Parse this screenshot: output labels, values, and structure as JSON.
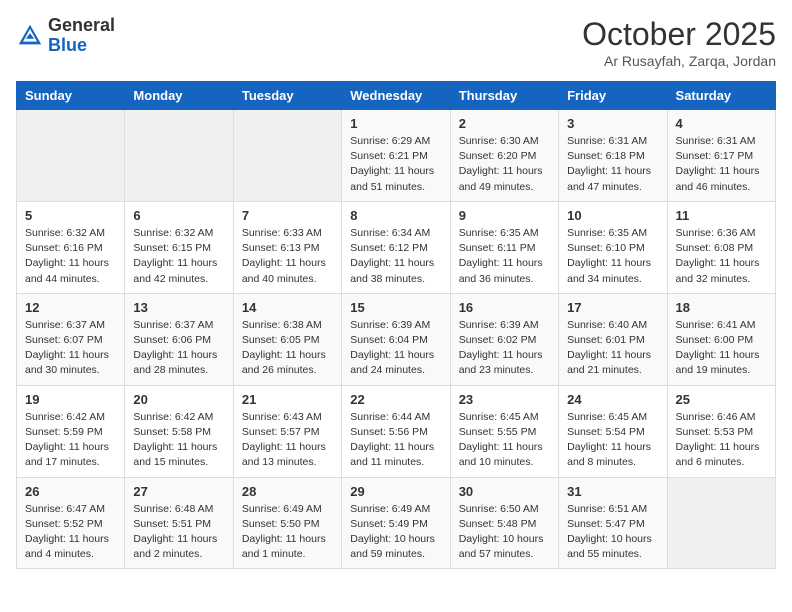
{
  "header": {
    "logo_general": "General",
    "logo_blue": "Blue",
    "month": "October 2025",
    "location": "Ar Rusayfah, Zarqa, Jordan"
  },
  "days_of_week": [
    "Sunday",
    "Monday",
    "Tuesday",
    "Wednesday",
    "Thursday",
    "Friday",
    "Saturday"
  ],
  "weeks": [
    [
      {
        "day": "",
        "info": ""
      },
      {
        "day": "",
        "info": ""
      },
      {
        "day": "",
        "info": ""
      },
      {
        "day": "1",
        "info": "Sunrise: 6:29 AM\nSunset: 6:21 PM\nDaylight: 11 hours\nand 51 minutes."
      },
      {
        "day": "2",
        "info": "Sunrise: 6:30 AM\nSunset: 6:20 PM\nDaylight: 11 hours\nand 49 minutes."
      },
      {
        "day": "3",
        "info": "Sunrise: 6:31 AM\nSunset: 6:18 PM\nDaylight: 11 hours\nand 47 minutes."
      },
      {
        "day": "4",
        "info": "Sunrise: 6:31 AM\nSunset: 6:17 PM\nDaylight: 11 hours\nand 46 minutes."
      }
    ],
    [
      {
        "day": "5",
        "info": "Sunrise: 6:32 AM\nSunset: 6:16 PM\nDaylight: 11 hours\nand 44 minutes."
      },
      {
        "day": "6",
        "info": "Sunrise: 6:32 AM\nSunset: 6:15 PM\nDaylight: 11 hours\nand 42 minutes."
      },
      {
        "day": "7",
        "info": "Sunrise: 6:33 AM\nSunset: 6:13 PM\nDaylight: 11 hours\nand 40 minutes."
      },
      {
        "day": "8",
        "info": "Sunrise: 6:34 AM\nSunset: 6:12 PM\nDaylight: 11 hours\nand 38 minutes."
      },
      {
        "day": "9",
        "info": "Sunrise: 6:35 AM\nSunset: 6:11 PM\nDaylight: 11 hours\nand 36 minutes."
      },
      {
        "day": "10",
        "info": "Sunrise: 6:35 AM\nSunset: 6:10 PM\nDaylight: 11 hours\nand 34 minutes."
      },
      {
        "day": "11",
        "info": "Sunrise: 6:36 AM\nSunset: 6:08 PM\nDaylight: 11 hours\nand 32 minutes."
      }
    ],
    [
      {
        "day": "12",
        "info": "Sunrise: 6:37 AM\nSunset: 6:07 PM\nDaylight: 11 hours\nand 30 minutes."
      },
      {
        "day": "13",
        "info": "Sunrise: 6:37 AM\nSunset: 6:06 PM\nDaylight: 11 hours\nand 28 minutes."
      },
      {
        "day": "14",
        "info": "Sunrise: 6:38 AM\nSunset: 6:05 PM\nDaylight: 11 hours\nand 26 minutes."
      },
      {
        "day": "15",
        "info": "Sunrise: 6:39 AM\nSunset: 6:04 PM\nDaylight: 11 hours\nand 24 minutes."
      },
      {
        "day": "16",
        "info": "Sunrise: 6:39 AM\nSunset: 6:02 PM\nDaylight: 11 hours\nand 23 minutes."
      },
      {
        "day": "17",
        "info": "Sunrise: 6:40 AM\nSunset: 6:01 PM\nDaylight: 11 hours\nand 21 minutes."
      },
      {
        "day": "18",
        "info": "Sunrise: 6:41 AM\nSunset: 6:00 PM\nDaylight: 11 hours\nand 19 minutes."
      }
    ],
    [
      {
        "day": "19",
        "info": "Sunrise: 6:42 AM\nSunset: 5:59 PM\nDaylight: 11 hours\nand 17 minutes."
      },
      {
        "day": "20",
        "info": "Sunrise: 6:42 AM\nSunset: 5:58 PM\nDaylight: 11 hours\nand 15 minutes."
      },
      {
        "day": "21",
        "info": "Sunrise: 6:43 AM\nSunset: 5:57 PM\nDaylight: 11 hours\nand 13 minutes."
      },
      {
        "day": "22",
        "info": "Sunrise: 6:44 AM\nSunset: 5:56 PM\nDaylight: 11 hours\nand 11 minutes."
      },
      {
        "day": "23",
        "info": "Sunrise: 6:45 AM\nSunset: 5:55 PM\nDaylight: 11 hours\nand 10 minutes."
      },
      {
        "day": "24",
        "info": "Sunrise: 6:45 AM\nSunset: 5:54 PM\nDaylight: 11 hours\nand 8 minutes."
      },
      {
        "day": "25",
        "info": "Sunrise: 6:46 AM\nSunset: 5:53 PM\nDaylight: 11 hours\nand 6 minutes."
      }
    ],
    [
      {
        "day": "26",
        "info": "Sunrise: 6:47 AM\nSunset: 5:52 PM\nDaylight: 11 hours\nand 4 minutes."
      },
      {
        "day": "27",
        "info": "Sunrise: 6:48 AM\nSunset: 5:51 PM\nDaylight: 11 hours\nand 2 minutes."
      },
      {
        "day": "28",
        "info": "Sunrise: 6:49 AM\nSunset: 5:50 PM\nDaylight: 11 hours\nand 1 minute."
      },
      {
        "day": "29",
        "info": "Sunrise: 6:49 AM\nSunset: 5:49 PM\nDaylight: 10 hours\nand 59 minutes."
      },
      {
        "day": "30",
        "info": "Sunrise: 6:50 AM\nSunset: 5:48 PM\nDaylight: 10 hours\nand 57 minutes."
      },
      {
        "day": "31",
        "info": "Sunrise: 6:51 AM\nSunset: 5:47 PM\nDaylight: 10 hours\nand 55 minutes."
      },
      {
        "day": "",
        "info": ""
      }
    ]
  ]
}
